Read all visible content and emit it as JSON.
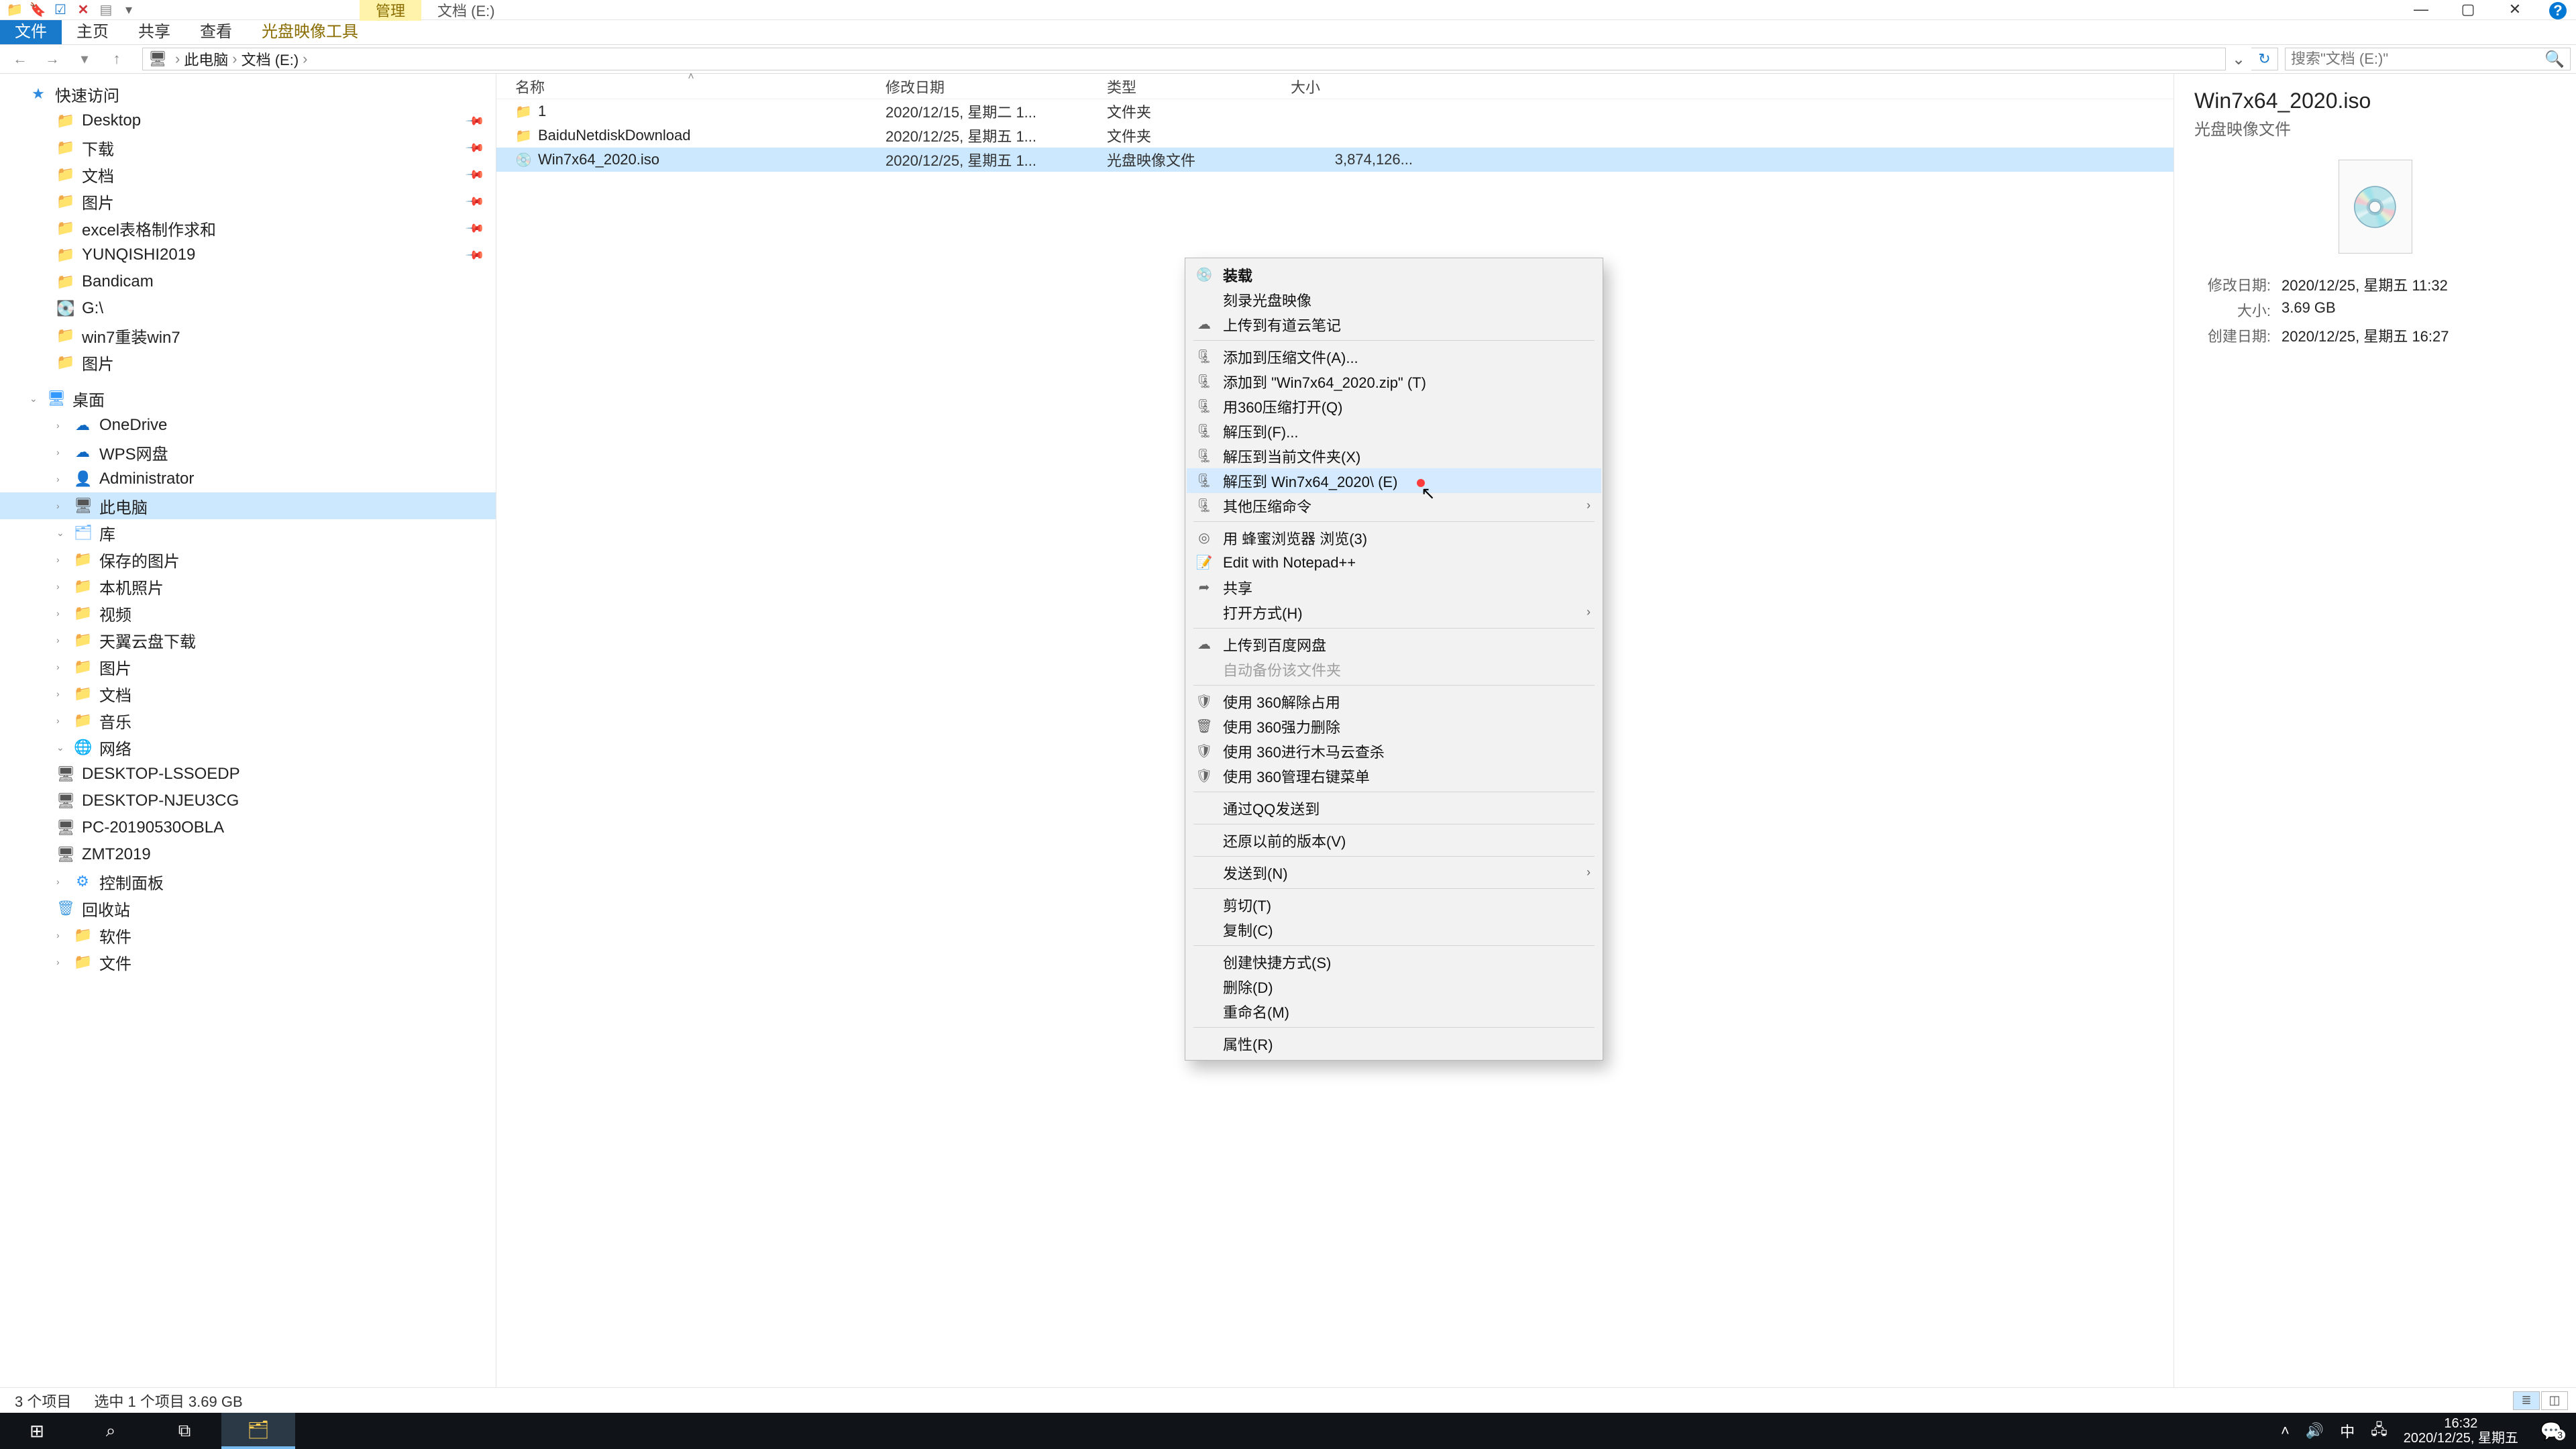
{
  "qat": {
    "ctx_manage": "管理",
    "ctx_drive": "文档 (E:)"
  },
  "wnd": {
    "min": "—",
    "max": "▢",
    "close": "✕",
    "help": "?"
  },
  "ribbon": {
    "file": "文件",
    "home": "主页",
    "share": "共享",
    "view": "查看",
    "iso": "光盘映像工具"
  },
  "crumbs": {
    "pc": "此电脑",
    "drive": "文档 (E:)"
  },
  "search": {
    "placeholder": "搜索\"文档 (E:)\""
  },
  "tree": {
    "quick": "快速访问",
    "desktop": "Desktop",
    "downloads": "下载",
    "documents": "文档",
    "pictures": "图片",
    "excel": "excel表格制作求和",
    "yunqishi": "YUNQISHI2019",
    "bandicam": "Bandicam",
    "gdrive": "G:\\",
    "win7": "win7重装win7",
    "pictures2": "图片",
    "desk": "桌面",
    "onedrive": "OneDrive",
    "wps": "WPS网盘",
    "admin": "Administrator",
    "thispc": "此电脑",
    "lib": "库",
    "savedpic": "保存的图片",
    "localpic": "本机照片",
    "video": "视频",
    "tianyi": "天翼云盘下载",
    "pictures3": "图片",
    "docs": "文档",
    "music": "音乐",
    "network": "网络",
    "d_lsso": "DESKTOP-LSSOEDP",
    "d_njeu": "DESKTOP-NJEU3CG",
    "d_pc19": "PC-20190530OBLA",
    "d_zmt": "ZMT2019",
    "ctrlpanel": "控制面板",
    "recycle": "回收站",
    "software": "软件",
    "files": "文件"
  },
  "cols": {
    "name": "名称",
    "date": "修改日期",
    "type": "类型",
    "size": "大小"
  },
  "rows": [
    {
      "name": "1",
      "date": "2020/12/15, 星期二 1...",
      "type": "文件夹",
      "size": ""
    },
    {
      "name": "BaiduNetdiskDownload",
      "date": "2020/12/25, 星期五 1...",
      "type": "文件夹",
      "size": ""
    },
    {
      "name": "Win7x64_2020.iso",
      "date": "2020/12/25, 星期五 1...",
      "type": "光盘映像文件",
      "size": "3,874,126..."
    }
  ],
  "pv": {
    "title": "Win7x64_2020.iso",
    "sub": "光盘映像文件",
    "mdate_k": "修改日期:",
    "mdate_v": "2020/12/25, 星期五 11:32",
    "size_k": "大小:",
    "size_v": "3.69 GB",
    "cdate_k": "创建日期:",
    "cdate_v": "2020/12/25, 星期五 16:27"
  },
  "status": {
    "count": "3 个项目",
    "sel": "选中 1 个项目  3.69 GB"
  },
  "ctx": {
    "mount": "装载",
    "burn": "刻录光盘映像",
    "youdao": "上传到有道云笔记",
    "addarchive": "添加到压缩文件(A)...",
    "addzip": "添加到 \"Win7x64_2020.zip\" (T)",
    "open360": "用360压缩打开(Q)",
    "extractto": "解压到(F)...",
    "extractcur": "解压到当前文件夹(X)",
    "extractnamed": "解压到 Win7x64_2020\\ (E)",
    "othercomp": "其他压缩命令",
    "honey": "用 蜂蜜浏览器 浏览(3)",
    "npp": "Edit with Notepad++",
    "share": "共享",
    "openwith": "打开方式(H)",
    "baidu": "上传到百度网盘",
    "autobackup": "自动备份该文件夹",
    "use360free": "使用 360解除占用",
    "use360del": "使用 360强力删除",
    "use360scan": "使用 360进行木马云查杀",
    "use360menu": "使用 360管理右键菜单",
    "qqsend": "通过QQ发送到",
    "restorever": "还原以前的版本(V)",
    "sendto": "发送到(N)",
    "cut": "剪切(T)",
    "copy": "复制(C)",
    "shortcut": "创建快捷方式(S)",
    "delete": "删除(D)",
    "rename": "重命名(M)",
    "props": "属性(R)"
  },
  "tray": {
    "ime": "中",
    "time": "16:32",
    "date": "2020/12/25, 星期五",
    "notif": "3"
  }
}
